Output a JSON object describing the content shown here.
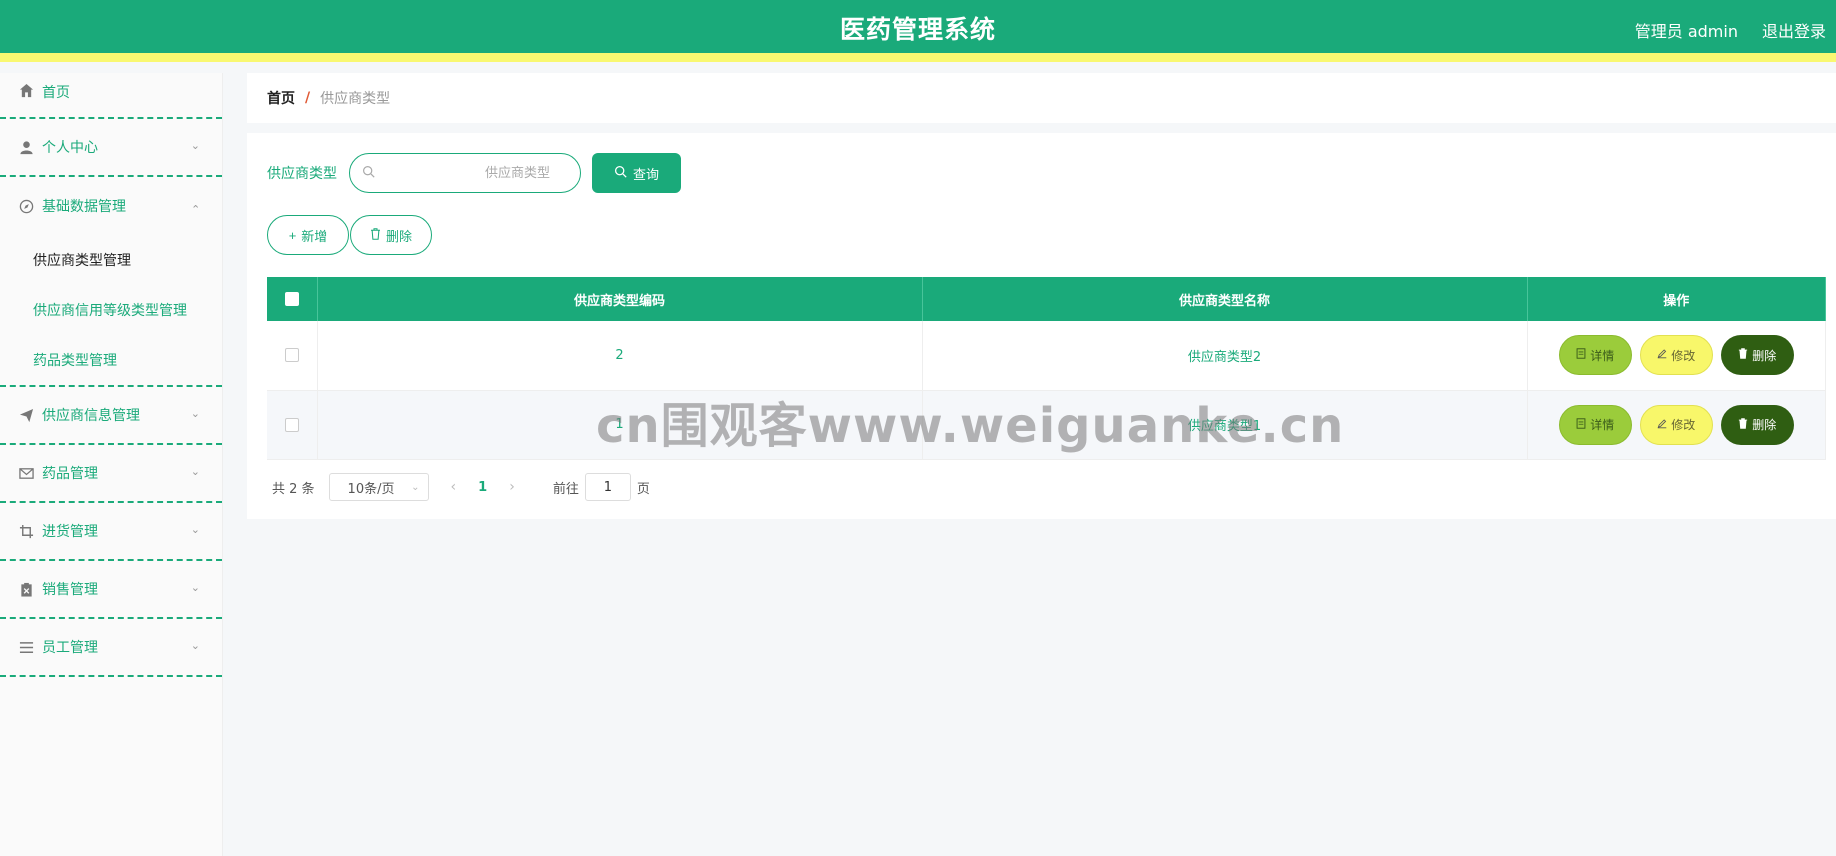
{
  "header": {
    "title": "医药管理系统",
    "user_label": "管理员 admin",
    "logout_label": "退出登录"
  },
  "sidebar": {
    "items": [
      {
        "label": "首页"
      },
      {
        "label": "个人中心"
      },
      {
        "label": "基础数据管理",
        "expanded": true,
        "children": [
          {
            "label": "供应商类型管理",
            "active": true
          },
          {
            "label": "供应商信用等级类型管理"
          },
          {
            "label": "药品类型管理"
          }
        ]
      },
      {
        "label": "供应商信息管理"
      },
      {
        "label": "药品管理"
      },
      {
        "label": "进货管理"
      },
      {
        "label": "销售管理"
      },
      {
        "label": "员工管理"
      }
    ]
  },
  "breadcrumb": {
    "home": "首页",
    "separator": "/",
    "current": "供应商类型"
  },
  "search": {
    "label": "供应商类型",
    "placeholder": "供应商类型",
    "value": "",
    "query_label": "查询"
  },
  "actions": {
    "add_label": "新增",
    "delete_label": "删除"
  },
  "table": {
    "columns": [
      "供应商类型编码",
      "供应商类型名称",
      "操作"
    ],
    "rows": [
      {
        "code": "2",
        "name": "供应商类型2"
      },
      {
        "code": "1",
        "name": "供应商类型1"
      }
    ],
    "op_detail": "详情",
    "op_edit": "修改",
    "op_delete": "删除"
  },
  "pagination": {
    "total_label": "共 2 条",
    "page_size": "10条/页",
    "current_page": "1",
    "goto_prefix": "前往",
    "goto_value": "1",
    "goto_suffix": "页"
  },
  "watermark": "cn围观客www.weiguanke.cn",
  "colors": {
    "primary": "#1aaa7a",
    "accent_yellow": "#f9f871",
    "detail_btn": "#9bcc3b",
    "edit_btn": "#f8f76a",
    "delete_btn": "#2f5e12"
  }
}
